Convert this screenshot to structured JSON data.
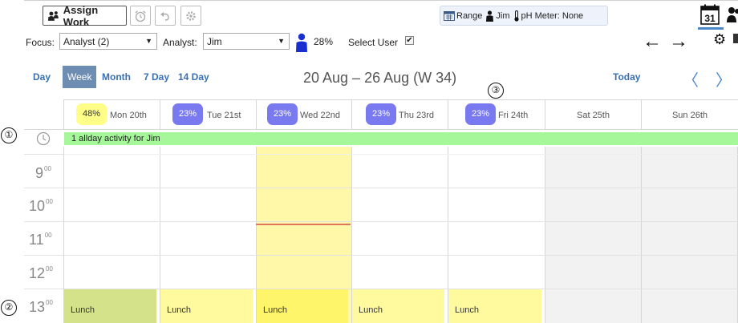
{
  "toolbar": {
    "assign_work_label": "Assign Work",
    "range_label": "Range",
    "user_label": "Jim",
    "ph_meter_label": "pH Meter: None",
    "calendar_day": "31"
  },
  "focus_bar": {
    "focus_label": "Focus:",
    "focus_value": "Analyst (2)",
    "analyst_label": "Analyst:",
    "analyst_value": "Jim",
    "utilization": "28%",
    "select_user_label": "Select User",
    "select_user_checked": "✔"
  },
  "nav": {
    "views": [
      "Day",
      "Week",
      "Month",
      "7 Day",
      "14 Day"
    ],
    "active_view": "Week",
    "range_title": "20 Aug – 26 Aug (W 34)",
    "today_label": "Today"
  },
  "days": [
    {
      "badge": "48%",
      "label": "Mon 20th",
      "highlight": true
    },
    {
      "badge": "23%",
      "label": "Tue 21st",
      "highlight": false
    },
    {
      "badge": "23%",
      "label": "Wed 22nd",
      "highlight": false
    },
    {
      "badge": "23%",
      "label": "Thu 23rd",
      "highlight": false
    },
    {
      "badge": "23%",
      "label": "Fri 24th",
      "highlight": false
    },
    {
      "badge": "",
      "label": "Sat 25th",
      "highlight": false
    },
    {
      "badge": "",
      "label": "Sun 26th",
      "highlight": false
    }
  ],
  "allday": {
    "text": "1 allday activity for Jim"
  },
  "hours": [
    {
      "hour": "9",
      "minutes": "00"
    },
    {
      "hour": "10",
      "minutes": "00"
    },
    {
      "hour": "11",
      "minutes": "00"
    },
    {
      "hour": "12",
      "minutes": "00"
    },
    {
      "hour": "13",
      "minutes": "00"
    }
  ],
  "lunch_label": "Lunch",
  "markers": [
    "①",
    "②",
    "③"
  ],
  "colors": {
    "accent": "#4a86c8",
    "badge": "#7a7af0",
    "badge_high": "#ffff88",
    "today_column": "#fff8a8",
    "allday_bar": "#a5f79a",
    "weekend": "#f2f2f2",
    "now_line": "#e0765c"
  }
}
